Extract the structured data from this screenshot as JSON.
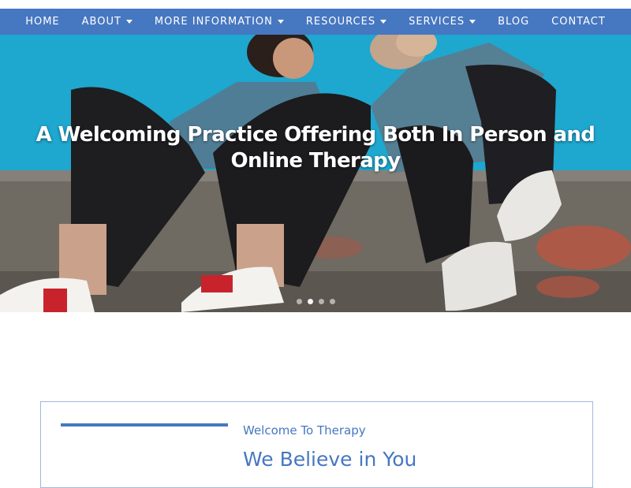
{
  "nav": {
    "items": [
      {
        "label": "HOME",
        "dropdown": false
      },
      {
        "label": "ABOUT",
        "dropdown": true
      },
      {
        "label": "MORE INFORMATION",
        "dropdown": true
      },
      {
        "label": "RESOURCES",
        "dropdown": true
      },
      {
        "label": "SERVICES",
        "dropdown": true
      },
      {
        "label": "BLOG",
        "dropdown": false
      },
      {
        "label": "CONTACT",
        "dropdown": false
      }
    ]
  },
  "hero": {
    "title": "A Welcoming Practice Offering Both In Person and Online Therapy",
    "slides": 4,
    "active_slide": 1
  },
  "welcome": {
    "subtitle": "Welcome To Therapy",
    "heading": "We Believe in You"
  },
  "colors": {
    "brand": "#4677c1",
    "sky": "#1ea7cf",
    "card_border": "#9fb9dc"
  }
}
